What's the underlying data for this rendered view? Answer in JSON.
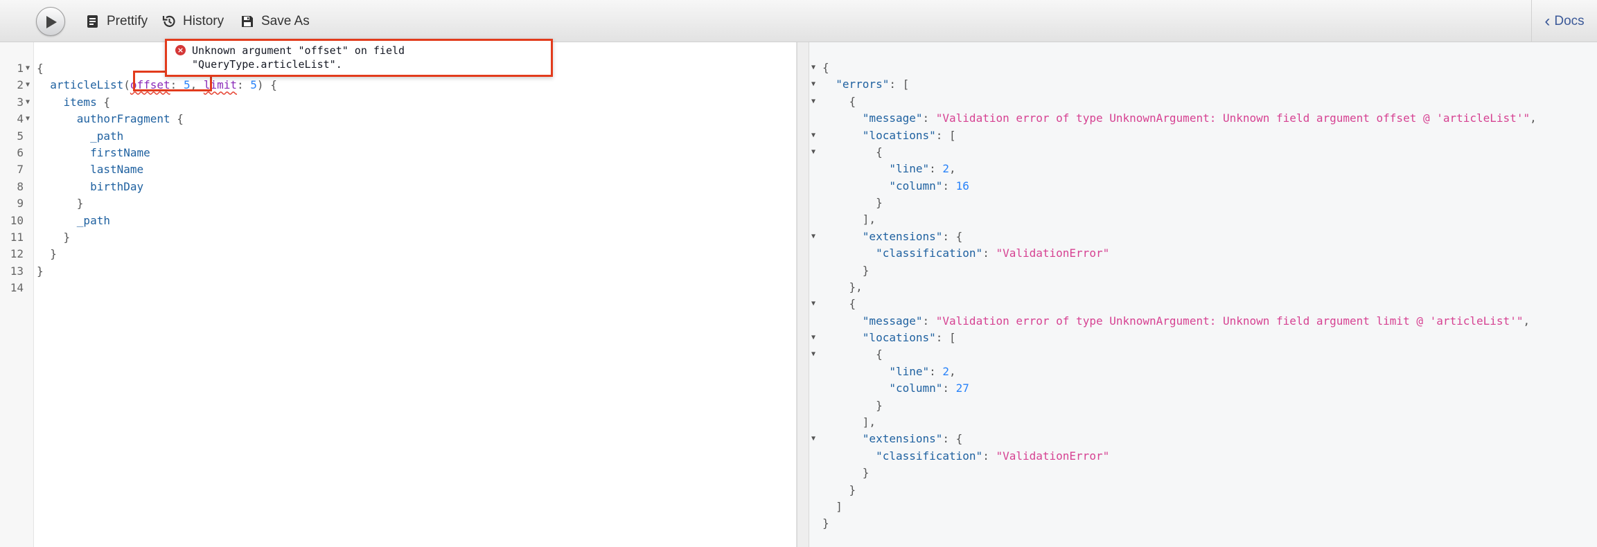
{
  "toolbar": {
    "execute_label": "Execute query",
    "prettify_label": "Prettify",
    "history_label": "History",
    "save_as_label": "Save As",
    "docs_label": "Docs"
  },
  "query_editor": {
    "lines": [
      {
        "num": "1",
        "fold": true,
        "tokens": [
          {
            "t": "{",
            "c": "punc"
          }
        ]
      },
      {
        "num": "2",
        "fold": true,
        "tokens": [
          {
            "t": "  "
          },
          {
            "t": "articleList",
            "c": "field"
          },
          {
            "t": "(",
            "c": "punc"
          },
          {
            "t": "offset",
            "c": "arg",
            "err": true
          },
          {
            "t": ": ",
            "c": "punc"
          },
          {
            "t": "5",
            "c": "num"
          },
          {
            "t": ", ",
            "c": "punc"
          },
          {
            "t": "limit",
            "c": "arg",
            "err": true
          },
          {
            "t": ": ",
            "c": "punc"
          },
          {
            "t": "5",
            "c": "num"
          },
          {
            "t": ") {",
            "c": "punc"
          }
        ]
      },
      {
        "num": "3",
        "fold": true,
        "tokens": [
          {
            "t": "    "
          },
          {
            "t": "items",
            "c": "field"
          },
          {
            "t": " {",
            "c": "punc"
          }
        ]
      },
      {
        "num": "4",
        "fold": true,
        "tokens": [
          {
            "t": "      "
          },
          {
            "t": "authorFragment",
            "c": "field"
          },
          {
            "t": " {",
            "c": "punc"
          }
        ]
      },
      {
        "num": "5",
        "fold": false,
        "tokens": [
          {
            "t": "        "
          },
          {
            "t": "_path",
            "c": "field"
          }
        ]
      },
      {
        "num": "6",
        "fold": false,
        "tokens": [
          {
            "t": "        "
          },
          {
            "t": "firstName",
            "c": "field"
          }
        ]
      },
      {
        "num": "7",
        "fold": false,
        "tokens": [
          {
            "t": "        "
          },
          {
            "t": "lastName",
            "c": "field"
          }
        ]
      },
      {
        "num": "8",
        "fold": false,
        "tokens": [
          {
            "t": "        "
          },
          {
            "t": "birthDay",
            "c": "field"
          }
        ]
      },
      {
        "num": "9",
        "fold": false,
        "tokens": [
          {
            "t": "      "
          },
          {
            "t": "}",
            "c": "punc"
          }
        ]
      },
      {
        "num": "10",
        "fold": false,
        "tokens": [
          {
            "t": "      "
          },
          {
            "t": "_path",
            "c": "field"
          }
        ]
      },
      {
        "num": "11",
        "fold": false,
        "tokens": [
          {
            "t": "    "
          },
          {
            "t": "}",
            "c": "punc"
          }
        ]
      },
      {
        "num": "12",
        "fold": false,
        "tokens": [
          {
            "t": "  "
          },
          {
            "t": "}",
            "c": "punc"
          }
        ]
      },
      {
        "num": "13",
        "fold": false,
        "tokens": [
          {
            "t": "}",
            "c": "punc"
          }
        ]
      },
      {
        "num": "14",
        "fold": false,
        "tokens": []
      }
    ],
    "error_tooltip": {
      "message": "Unknown argument \"offset\" on field\n\"QueryType.articleList\".",
      "icon": "error-icon"
    }
  },
  "result_viewer": {
    "lines": [
      {
        "fold": true,
        "tokens": [
          {
            "t": "{",
            "c": "punc"
          }
        ]
      },
      {
        "fold": true,
        "tokens": [
          {
            "t": "  "
          },
          {
            "t": "\"errors\"",
            "c": "key"
          },
          {
            "t": ": [",
            "c": "punc"
          }
        ]
      },
      {
        "fold": true,
        "tokens": [
          {
            "t": "    {",
            "c": "punc"
          }
        ]
      },
      {
        "fold": false,
        "tokens": [
          {
            "t": "      "
          },
          {
            "t": "\"message\"",
            "c": "key"
          },
          {
            "t": ": ",
            "c": "punc"
          },
          {
            "t": "\"Validation error of type UnknownArgument: Unknown field argument offset @ 'articleList'\"",
            "c": "str"
          },
          {
            "t": ",",
            "c": "punc"
          }
        ]
      },
      {
        "fold": true,
        "tokens": [
          {
            "t": "      "
          },
          {
            "t": "\"locations\"",
            "c": "key"
          },
          {
            "t": ": [",
            "c": "punc"
          }
        ]
      },
      {
        "fold": true,
        "tokens": [
          {
            "t": "        {",
            "c": "punc"
          }
        ]
      },
      {
        "fold": false,
        "tokens": [
          {
            "t": "          "
          },
          {
            "t": "\"line\"",
            "c": "key"
          },
          {
            "t": ": ",
            "c": "punc"
          },
          {
            "t": "2",
            "c": "num"
          },
          {
            "t": ",",
            "c": "punc"
          }
        ]
      },
      {
        "fold": false,
        "tokens": [
          {
            "t": "          "
          },
          {
            "t": "\"column\"",
            "c": "key"
          },
          {
            "t": ": ",
            "c": "punc"
          },
          {
            "t": "16",
            "c": "num"
          }
        ]
      },
      {
        "fold": false,
        "tokens": [
          {
            "t": "        }",
            "c": "punc"
          }
        ]
      },
      {
        "fold": false,
        "tokens": [
          {
            "t": "      ],",
            "c": "punc"
          }
        ]
      },
      {
        "fold": true,
        "tokens": [
          {
            "t": "      "
          },
          {
            "t": "\"extensions\"",
            "c": "key"
          },
          {
            "t": ": {",
            "c": "punc"
          }
        ]
      },
      {
        "fold": false,
        "tokens": [
          {
            "t": "        "
          },
          {
            "t": "\"classification\"",
            "c": "key"
          },
          {
            "t": ": ",
            "c": "punc"
          },
          {
            "t": "\"ValidationError\"",
            "c": "str"
          }
        ]
      },
      {
        "fold": false,
        "tokens": [
          {
            "t": "      }",
            "c": "punc"
          }
        ]
      },
      {
        "fold": false,
        "tokens": [
          {
            "t": "    },",
            "c": "punc"
          }
        ]
      },
      {
        "fold": true,
        "tokens": [
          {
            "t": "    {",
            "c": "punc"
          }
        ]
      },
      {
        "fold": false,
        "tokens": [
          {
            "t": "      "
          },
          {
            "t": "\"message\"",
            "c": "key"
          },
          {
            "t": ": ",
            "c": "punc"
          },
          {
            "t": "\"Validation error of type UnknownArgument: Unknown field argument limit @ 'articleList'\"",
            "c": "str"
          },
          {
            "t": ",",
            "c": "punc"
          }
        ]
      },
      {
        "fold": true,
        "tokens": [
          {
            "t": "      "
          },
          {
            "t": "\"locations\"",
            "c": "key"
          },
          {
            "t": ": [",
            "c": "punc"
          }
        ]
      },
      {
        "fold": true,
        "tokens": [
          {
            "t": "        {",
            "c": "punc"
          }
        ]
      },
      {
        "fold": false,
        "tokens": [
          {
            "t": "          "
          },
          {
            "t": "\"line\"",
            "c": "key"
          },
          {
            "t": ": ",
            "c": "punc"
          },
          {
            "t": "2",
            "c": "num"
          },
          {
            "t": ",",
            "c": "punc"
          }
        ]
      },
      {
        "fold": false,
        "tokens": [
          {
            "t": "          "
          },
          {
            "t": "\"column\"",
            "c": "key"
          },
          {
            "t": ": ",
            "c": "punc"
          },
          {
            "t": "27",
            "c": "num"
          }
        ]
      },
      {
        "fold": false,
        "tokens": [
          {
            "t": "        }",
            "c": "punc"
          }
        ]
      },
      {
        "fold": false,
        "tokens": [
          {
            "t": "      ],",
            "c": "punc"
          }
        ]
      },
      {
        "fold": true,
        "tokens": [
          {
            "t": "      "
          },
          {
            "t": "\"extensions\"",
            "c": "key"
          },
          {
            "t": ": {",
            "c": "punc"
          }
        ]
      },
      {
        "fold": false,
        "tokens": [
          {
            "t": "        "
          },
          {
            "t": "\"classification\"",
            "c": "key"
          },
          {
            "t": ": ",
            "c": "punc"
          },
          {
            "t": "\"ValidationError\"",
            "c": "str"
          }
        ]
      },
      {
        "fold": false,
        "tokens": [
          {
            "t": "      }",
            "c": "punc"
          }
        ]
      },
      {
        "fold": false,
        "tokens": [
          {
            "t": "    }",
            "c": "punc"
          }
        ]
      },
      {
        "fold": false,
        "tokens": [
          {
            "t": "  ]",
            "c": "punc"
          }
        ]
      },
      {
        "fold": false,
        "tokens": [
          {
            "t": "}",
            "c": "punc"
          }
        ]
      }
    ]
  },
  "colors": {
    "field": "#1f61a0",
    "argument": "#8b2bb9",
    "number": "#2882f9",
    "string": "#d64292",
    "error_border": "#e23b1c",
    "docs_link": "#3b5998"
  }
}
